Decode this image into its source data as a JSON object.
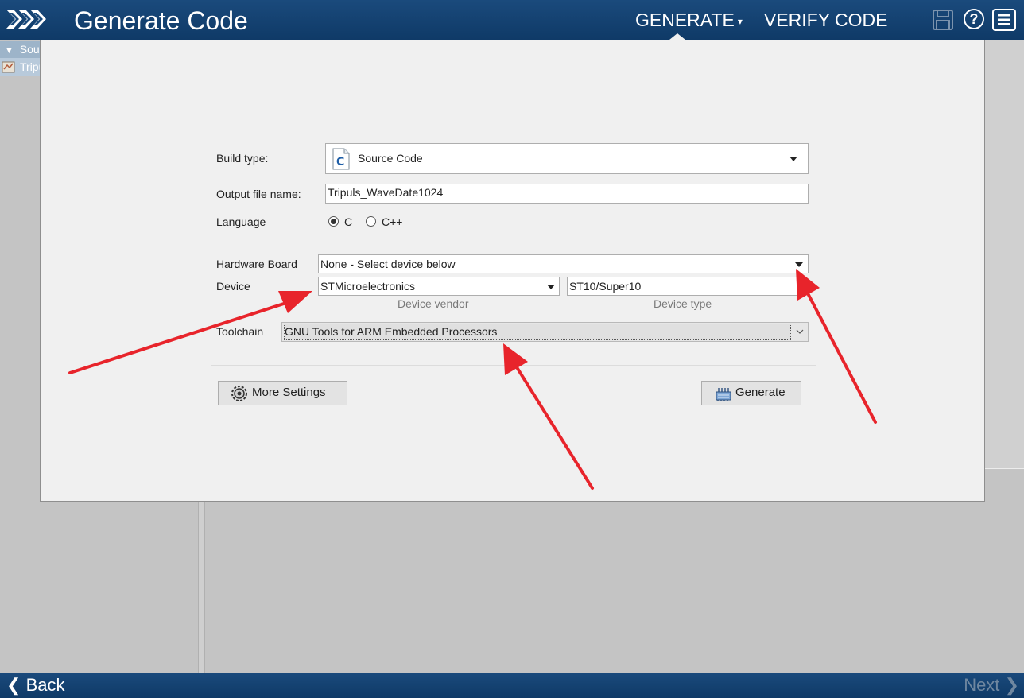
{
  "header": {
    "title": "Generate Code",
    "tabs": [
      {
        "label": "GENERATE",
        "caret": "▾",
        "active": true
      },
      {
        "label": "VERIFY CODE",
        "active": false
      }
    ],
    "icons": [
      "forward-chevrons-icon",
      "save-icon",
      "help-icon",
      "menu-icon"
    ],
    "help_glyph": "?"
  },
  "sidebar": {
    "items": [
      {
        "toggle": "▼",
        "label": "Source"
      },
      {
        "label": "Tripuls"
      }
    ]
  },
  "form": {
    "build_type": {
      "label": "Build type:",
      "value": "Source Code",
      "icon_letter": "C"
    },
    "output_file": {
      "label": "Output file name:",
      "value": "Tripuls_WaveDate1024"
    },
    "language": {
      "label": "Language",
      "options": [
        "C",
        "C++"
      ],
      "selected": "C"
    },
    "hardware_board": {
      "label": "Hardware Board",
      "value": "None - Select device below"
    },
    "device": {
      "label": "Device",
      "vendor": {
        "value": "STMicroelectronics",
        "caption": "Device vendor"
      },
      "type": {
        "value": "ST10/Super10",
        "caption": "Device type"
      }
    },
    "toolchain": {
      "label": "Toolchain",
      "value": "GNU Tools for ARM Embedded Processors"
    },
    "buttons": {
      "more_settings": "More Settings",
      "generate": "Generate"
    }
  },
  "footer": {
    "back": "Back",
    "next": "Next",
    "back_glyph": "❮",
    "next_glyph": "❯"
  },
  "colors": {
    "header": "#12406f",
    "dialog": "#f0f0f0",
    "annotation_arrow": "#e8242b"
  }
}
